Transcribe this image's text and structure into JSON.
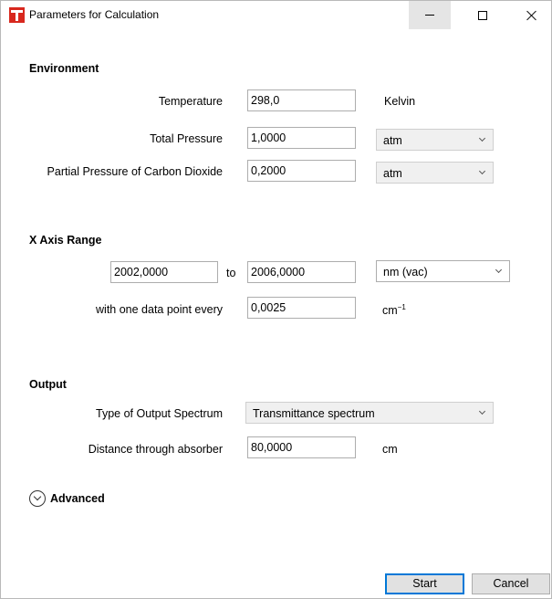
{
  "window": {
    "title": "Parameters for Calculation"
  },
  "environment": {
    "heading": "Environment",
    "temperature": {
      "label": "Temperature",
      "value": "298,0",
      "unit": "Kelvin"
    },
    "total_pressure": {
      "label": "Total Pressure",
      "value": "1,0000",
      "unit": "atm"
    },
    "partial_pressure": {
      "label": "Partial Pressure of Carbon Dioxide",
      "value": "0,2000",
      "unit": "atm"
    }
  },
  "x_axis": {
    "heading": "X Axis Range",
    "from_value": "2002,0000",
    "to_label": "to",
    "to_value": "2006,0000",
    "unit": "nm (vac)",
    "step_label": "with one data point every",
    "step_value": "0,0025",
    "step_unit": "cm",
    "step_unit_sup": "−1"
  },
  "output": {
    "heading": "Output",
    "type_label": "Type of Output Spectrum",
    "type_value": "Transmittance spectrum",
    "distance_label": "Distance through absorber",
    "distance_value": "80,0000",
    "distance_unit": "cm"
  },
  "advanced": {
    "label": "Advanced"
  },
  "buttons": {
    "start": "Start",
    "cancel": "Cancel"
  }
}
